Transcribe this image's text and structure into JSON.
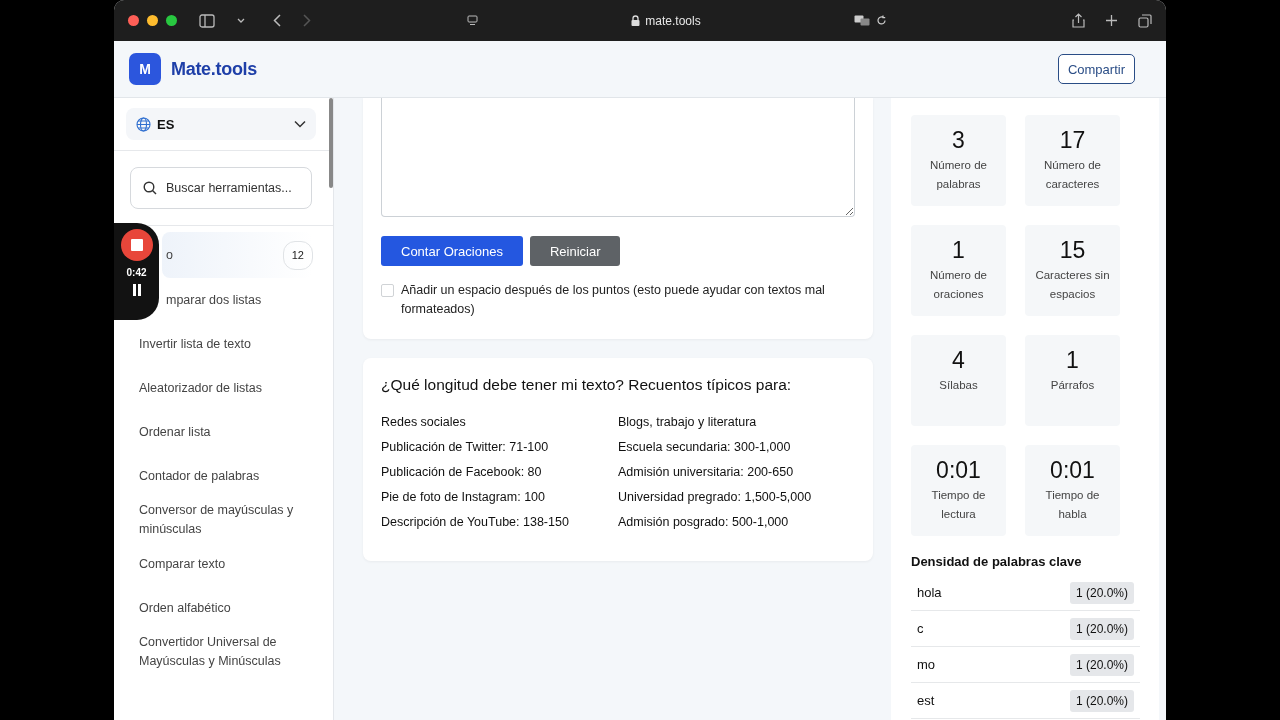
{
  "browser": {
    "url": "mate.tools"
  },
  "header": {
    "logo_letter": "M",
    "brand": "Mate.tools",
    "share_button": "Compartir"
  },
  "sidebar": {
    "language": "ES",
    "search": {
      "placeholder": "Buscar herramientas..."
    },
    "items": [
      {
        "label": "o",
        "count": "12",
        "selected": true,
        "partial": true
      },
      {
        "label": "mparar dos listas",
        "selected": false,
        "partial": true
      },
      {
        "label": "Invertir lista de texto",
        "selected": false,
        "partial": false
      },
      {
        "label": "Aleatorizador de listas",
        "selected": false,
        "partial": false
      },
      {
        "label": "Ordenar lista",
        "selected": false,
        "partial": false
      },
      {
        "label": "Contador de palabras",
        "selected": false,
        "partial": false
      },
      {
        "label": "Conversor de mayúsculas y minúsculas",
        "selected": false,
        "partial": false
      },
      {
        "label": "Comparar texto",
        "selected": false,
        "partial": false
      },
      {
        "label": "Orden alfabético",
        "selected": false,
        "partial": false
      },
      {
        "label": "Convertidor Universal de Mayúsculas y Minúsculas",
        "selected": false,
        "partial": false
      }
    ]
  },
  "recorder": {
    "time": "0:42"
  },
  "tool": {
    "buttons": [
      {
        "label": "Contar Oraciones",
        "kind": "primary"
      },
      {
        "label": "Reiniciar",
        "kind": "secondary"
      }
    ],
    "option": {
      "label": "Añadir un espacio después de los puntos (esto puede ayudar con textos mal formateados)",
      "checked": false
    }
  },
  "lengths": {
    "title": "¿Qué longitud debe tener mi texto? Recuentos típicos para:",
    "columns": [
      {
        "heading": "Redes sociales",
        "lines": [
          "Publicación de Twitter: 71-100",
          "Publicación de Facebook: 80",
          "Pie de foto de Instagram: 100",
          "Descripción de YouTube: 138-150"
        ]
      },
      {
        "heading": "Blogs, trabajo y literatura",
        "lines": [
          "Escuela secundaria: 300-1,000",
          "Admisión universitaria: 200-650",
          "Universidad pregrado: 1,500-5,000",
          "Admisión posgrado: 500-1,000"
        ]
      }
    ]
  },
  "stats": [
    {
      "value": "3",
      "label": "Número de palabras"
    },
    {
      "value": "17",
      "label": "Número de caracteres"
    },
    {
      "value": "1",
      "label": "Número de oraciones"
    },
    {
      "value": "15",
      "label": "Caracteres sin espacios"
    },
    {
      "value": "4",
      "label": "Sílabas"
    },
    {
      "value": "1",
      "label": "Párrafos"
    },
    {
      "value": "0:01",
      "label": "Tiempo de lectura"
    },
    {
      "value": "0:01",
      "label": "Tiempo de habla"
    }
  ],
  "keyword_density": {
    "title": "Densidad de palabras clave",
    "rows": [
      {
        "word": "hola",
        "count": "1 (20.0%)"
      },
      {
        "word": "c",
        "count": "1 (20.0%)"
      },
      {
        "word": "mo",
        "count": "1 (20.0%)"
      },
      {
        "word": "est",
        "count": "1 (20.0%)"
      }
    ]
  }
}
